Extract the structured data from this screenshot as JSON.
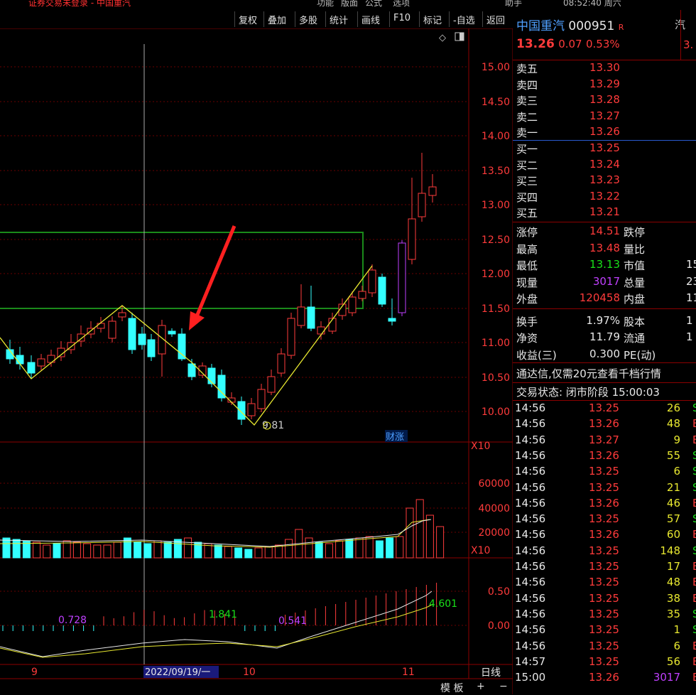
{
  "window": {
    "top_items": [
      "证券交易未登录 - 中国重汽",
      "功能",
      "版面",
      "公式",
      "选项",
      "助手",
      "08:52:40 周六"
    ]
  },
  "toolbar": {
    "buttons": [
      "复权",
      "叠加",
      "多股",
      "统计",
      "画线",
      "F10",
      "标记",
      "-自选",
      "返回"
    ]
  },
  "chart": {
    "price_axis": [
      "15.00",
      "14.50",
      "14.00",
      "13.50",
      "13.00",
      "12.50",
      "12.00",
      "11.50",
      "11.00",
      "10.50",
      "10.00"
    ],
    "volume_axis": [
      "60000",
      "40000",
      "20000"
    ],
    "macd_axis": [
      "0.50",
      "0.00"
    ],
    "x10_label": "X10",
    "date_labels": [
      "9",
      "2022/09/19/一",
      "10",
      "11"
    ],
    "annotations": {
      "low_mark": "9.81",
      "badge": "财涨",
      "macd_a": "0.728",
      "macd_b": "1.841",
      "macd_c": "0.541",
      "macd_d": "4.601"
    },
    "period_label": "日线",
    "bottom_buttons": [
      "模 板",
      "+",
      "−"
    ]
  },
  "quote": {
    "name": "中国重汽",
    "code": "000951",
    "tag": "R",
    "price": "13.26",
    "change": "0.07",
    "pct": "0.53%",
    "asks": [
      {
        "label": "卖五",
        "price": "13.30"
      },
      {
        "label": "卖四",
        "price": "13.29"
      },
      {
        "label": "卖三",
        "price": "13.28"
      },
      {
        "label": "卖二",
        "price": "13.27"
      },
      {
        "label": "卖一",
        "price": "13.26"
      }
    ],
    "bids": [
      {
        "label": "买一",
        "price": "13.25"
      },
      {
        "label": "买二",
        "price": "13.24"
      },
      {
        "label": "买三",
        "price": "13.23"
      },
      {
        "label": "买四",
        "price": "13.22"
      },
      {
        "label": "买五",
        "price": "13.21"
      }
    ],
    "stats": [
      {
        "l1": "涨停",
        "v1": "14.51",
        "c1": "red",
        "l2": "跌停",
        "v2": ""
      },
      {
        "l1": "最高",
        "v1": "13.48",
        "c1": "red",
        "l2": "量比",
        "v2": ""
      },
      {
        "l1": "最低",
        "v1": "13.13",
        "c1": "green",
        "l2": "市值",
        "v2": "15"
      },
      {
        "l1": "现量",
        "v1": "3017",
        "c1": "purple",
        "l2": "总量",
        "v2": "23"
      },
      {
        "l1": "外盘",
        "v1": "120458",
        "c1": "red",
        "l2": "内盘",
        "v2": "11"
      },
      {
        "l1": "换手",
        "v1": "1.97%",
        "c1": "white",
        "l2": "股本",
        "v2": "1"
      },
      {
        "l1": "净资",
        "v1": "11.79",
        "c1": "white",
        "l2": "流通",
        "v2": "1"
      },
      {
        "l1": "收益(三)",
        "v1": "0.300",
        "c1": "white",
        "l2": "PE(动)",
        "v2": ""
      }
    ],
    "notice": "通达信,仅需20元查看千档行情",
    "status": "交易状态: 闭市阶段 15:00:03",
    "ticks": [
      {
        "t": "14:56",
        "p": "13.25",
        "v": "26",
        "f": "S"
      },
      {
        "t": "14:56",
        "p": "13.26",
        "v": "48",
        "f": "B"
      },
      {
        "t": "14:56",
        "p": "13.27",
        "v": "9",
        "f": "B"
      },
      {
        "t": "14:56",
        "p": "13.26",
        "v": "55",
        "f": "S"
      },
      {
        "t": "14:56",
        "p": "13.25",
        "v": "6",
        "f": "S"
      },
      {
        "t": "14:56",
        "p": "13.25",
        "v": "21",
        "f": "S"
      },
      {
        "t": "14:56",
        "p": "13.26",
        "v": "46",
        "f": "B"
      },
      {
        "t": "14:56",
        "p": "13.25",
        "v": "57",
        "f": "S"
      },
      {
        "t": "14:56",
        "p": "13.26",
        "v": "60",
        "f": "B"
      },
      {
        "t": "14:56",
        "p": "13.25",
        "v": "148",
        "f": "S"
      },
      {
        "t": "14:56",
        "p": "13.25",
        "v": "17",
        "f": "B"
      },
      {
        "t": "14:56",
        "p": "13.25",
        "v": "48",
        "f": "B"
      },
      {
        "t": "14:56",
        "p": "13.25",
        "v": "38",
        "f": "B"
      },
      {
        "t": "14:56",
        "p": "13.25",
        "v": "35",
        "f": "S"
      },
      {
        "t": "14:56",
        "p": "13.25",
        "v": "1",
        "f": "S"
      },
      {
        "t": "14:56",
        "p": "13.25",
        "v": "6",
        "f": "B"
      },
      {
        "t": "14:57",
        "p": "13.25",
        "v": "56",
        "f": "B"
      },
      {
        "t": "15:00",
        "p": "13.26",
        "v": "3017",
        "f": "B"
      }
    ],
    "side_chars": [
      "汽",
      "3."
    ]
  }
}
